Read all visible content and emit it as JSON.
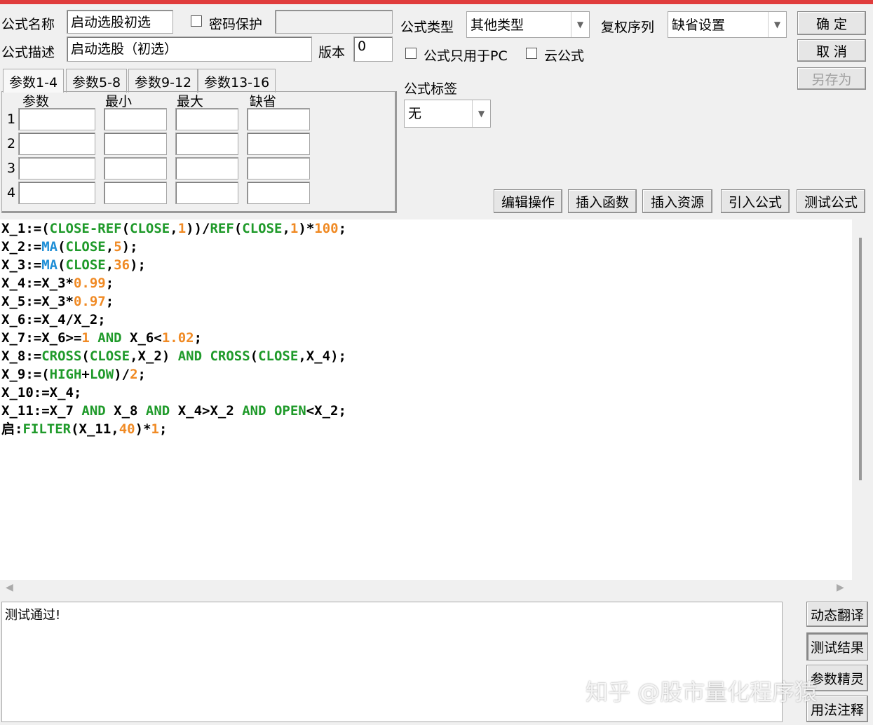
{
  "header": {
    "name_label": "公式名称",
    "name_value": "启动选股初选",
    "password_label": "密码保护",
    "password_value": "",
    "desc_label": "公式描述",
    "desc_value": "启动选股（初选）",
    "version_label": "版本",
    "version_value": "0",
    "type_label": "公式类型",
    "type_value": "其他类型",
    "adjust_label": "复权序列",
    "adjust_value": "缺省设置",
    "pc_only_label": "公式只用于PC",
    "cloud_label": "云公式",
    "tag_label": "公式标签",
    "tag_value": "无",
    "ok": "确  定",
    "cancel": "取  消",
    "save_as": "另存为"
  },
  "tabs": [
    "参数1-4",
    "参数5-8",
    "参数9-12",
    "参数13-16"
  ],
  "params": {
    "headers": [
      "参数",
      "最小",
      "最大",
      "缺省"
    ],
    "rows": [
      "1",
      "2",
      "3",
      "4"
    ]
  },
  "toolbar": [
    "编辑操作",
    "插入函数",
    "插入资源",
    "引入公式",
    "测试公式"
  ],
  "code": [
    [
      [
        "",
        "X_1:=("
      ],
      [
        "k",
        "CLOSE-REF"
      ],
      [
        "",
        "("
      ],
      [
        "k",
        "CLOSE"
      ],
      [
        "",
        ","
      ],
      [
        "n",
        "1"
      ],
      [
        "",
        "))/"
      ],
      [
        "k",
        "REF"
      ],
      [
        "",
        "("
      ],
      [
        "k",
        "CLOSE"
      ],
      [
        "",
        ","
      ],
      [
        "n",
        "1"
      ],
      [
        "",
        ")*"
      ],
      [
        "n",
        "100"
      ],
      [
        "",
        ";"
      ]
    ],
    [
      [
        "",
        "X_2:="
      ],
      [
        "f",
        "MA"
      ],
      [
        "",
        "("
      ],
      [
        "k",
        "CLOSE"
      ],
      [
        "",
        ","
      ],
      [
        "n",
        "5"
      ],
      [
        "",
        ");"
      ]
    ],
    [
      [
        "",
        "X_3:="
      ],
      [
        "f",
        "MA"
      ],
      [
        "",
        "("
      ],
      [
        "k",
        "CLOSE"
      ],
      [
        "",
        ","
      ],
      [
        "n",
        "36"
      ],
      [
        "",
        ");"
      ]
    ],
    [
      [
        "",
        "X_4:=X_3*"
      ],
      [
        "n",
        "0.99"
      ],
      [
        "",
        ";"
      ]
    ],
    [
      [
        "",
        "X_5:=X_3*"
      ],
      [
        "n",
        "0.97"
      ],
      [
        "",
        ";"
      ]
    ],
    [
      [
        "",
        "X_6:=X_4/X_2;"
      ]
    ],
    [
      [
        "",
        "X_7:=X_6>="
      ],
      [
        "n",
        "1"
      ],
      [
        "k",
        " AND"
      ],
      [
        "",
        " X_6<"
      ],
      [
        "n",
        "1.02"
      ],
      [
        "",
        ";"
      ]
    ],
    [
      [
        "",
        "X_8:="
      ],
      [
        "k",
        "CROSS"
      ],
      [
        "",
        "("
      ],
      [
        "k",
        "CLOSE"
      ],
      [
        "",
        ",X_2) "
      ],
      [
        "k",
        "AND CROSS"
      ],
      [
        "",
        "("
      ],
      [
        "k",
        "CLOSE"
      ],
      [
        "",
        ",X_4);"
      ]
    ],
    [
      [
        "",
        "X_9:=("
      ],
      [
        "k",
        "HIGH"
      ],
      [
        "",
        "+"
      ],
      [
        "k",
        "LOW"
      ],
      [
        "",
        ")/"
      ],
      [
        "n",
        "2"
      ],
      [
        "",
        ";"
      ]
    ],
    [
      [
        "",
        "X_10:=X_4;"
      ]
    ],
    [
      [
        "",
        "X_11:=X_7 "
      ],
      [
        "k",
        "AND"
      ],
      [
        "",
        " X_8 "
      ],
      [
        "k",
        "AND"
      ],
      [
        "",
        " X_4>X_2 "
      ],
      [
        "k",
        "AND OPEN"
      ],
      [
        "",
        "<X_2;"
      ]
    ],
    [
      [
        "",
        "启:"
      ],
      [
        "k",
        "FILTER"
      ],
      [
        "",
        "(X_11,"
      ],
      [
        "n",
        "40"
      ],
      [
        "",
        ")*"
      ],
      [
        "n",
        "1"
      ],
      [
        "",
        ";"
      ]
    ]
  ],
  "output": {
    "text": "测试通过!"
  },
  "side_buttons": [
    "动态翻译",
    "测试结果",
    "参数精灵",
    "用法注释"
  ],
  "watermark": "知乎 @股市量化程序猿"
}
